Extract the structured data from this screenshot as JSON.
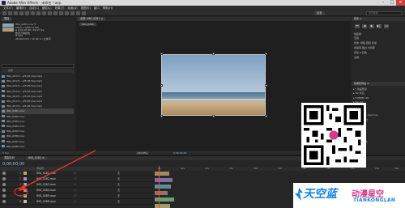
{
  "window": {
    "title": "Adobe After Effects - 未命名 *.aep"
  },
  "menu": [
    "文件(F)",
    "编辑(E)",
    "合成(C)",
    "图层(L)",
    "效果(T)",
    "动画(A)",
    "视图(V)",
    "窗口",
    "帮助(H)"
  ],
  "toolbar": {
    "workspace": "标准",
    "search_placeholder": "搜索帮助"
  },
  "project": {
    "tab": "项目",
    "info": [
      "IMG_0281.mov ▾",
      "1920 x 1080 (1.00)",
      "Δ 0;00;05;00, 29.97 fps",
      "数百万种颜色",
      "H.264",
      "48.000 kHz / 32 bit U / 立体声"
    ],
    "columns": "名称",
    "files": [
      "IMG_20171...(25.95 fps).mp4",
      "IMG_20171...(25.95 fps).mp4",
      "IMG_20171...(25.95 fps).mp4",
      "IMG_20171...(25.95 fps).mp4",
      "IMG_20171...(25.95 fps).mp4",
      "IMG_20171...(25.95 fps).mp4",
      "IMG_20171...(25.95 fps).mp4",
      "IMG_0281.mov",
      "IMG_0282.mov",
      "IMG_0283.mov",
      "IMG_0284.mov",
      "IMG_0285.mov",
      "IMG_0286.mov",
      "IMG_0287.mov",
      "IMG_0288.mov",
      "IMG_0289.mov",
      "IMG_0290.mov",
      "IMG_0291.mov",
      "IMG_0292.mov"
    ],
    "footer": "8 bpc"
  },
  "composition": {
    "tab": "合成: IMG_0281 ≡",
    "crumb": "IMG_0281",
    "zoom": "(31.5%)",
    "timecode": "0;00;00;00"
  },
  "right": {
    "preview_tab": "预览 ≡",
    "preview_controls": [
      "⏮",
      "◀",
      "▶",
      "▶▏",
      "⏭"
    ],
    "rows": [
      "快捷键",
      "空格",
      "包含: 视频 音频 叠加",
      "帧速率 跳过 分辨率",
      "自动 0 自动",
      "全屏"
    ],
    "effects_tab": "效果和预设 ≡",
    "effects": [
      "▸ * 动画预设",
      "▸ 3D 声道",
      "▸ CINEMA 4D",
      "▸ Keying",
      "▸ Matte",
      "▸ Obsolete",
      "▸ Synthetic Aperture",
      "▸ 表达式控制",
      "▸ 风格化",
      "▸ 过渡",
      "▸ 过时",
      "▸ 抠像",
      "▸ 模糊和锐化"
    ]
  },
  "timeline": {
    "tabs": [
      "渲染队列",
      "IMG_0281 ≡"
    ],
    "timecode": "0;00;00;00",
    "header": "源名称",
    "layers": [
      {
        "num": "1",
        "name": "IMG_0281.mov",
        "parent": "无"
      },
      {
        "num": "2",
        "name": "IMG_0282.mov",
        "parent": "无"
      },
      {
        "num": "3",
        "name": "IMG_0283.mov",
        "parent": "无"
      },
      {
        "num": "4",
        "name": "IMG_0284.mov",
        "parent": "无"
      },
      {
        "num": "5",
        "name": "IMG_0285.mov",
        "parent": "无"
      },
      {
        "num": "6",
        "name": "IMG_0286.mov",
        "parent": "无"
      }
    ],
    "ruler": [
      "0s",
      "02s",
      "04s",
      "06s",
      "08s",
      "10s",
      "12s",
      "14s",
      "16s",
      "18s",
      "20s"
    ]
  },
  "watermark": {
    "cn_left": "天空蓝",
    "cn_right": "动漫星空",
    "en": "TIANKONGLAN"
  },
  "colors": {
    "accent": "#8fbfe8",
    "arrow": "#e8322a",
    "brand_blue": "#1584e0",
    "brand_pink": "#d53a8a"
  }
}
